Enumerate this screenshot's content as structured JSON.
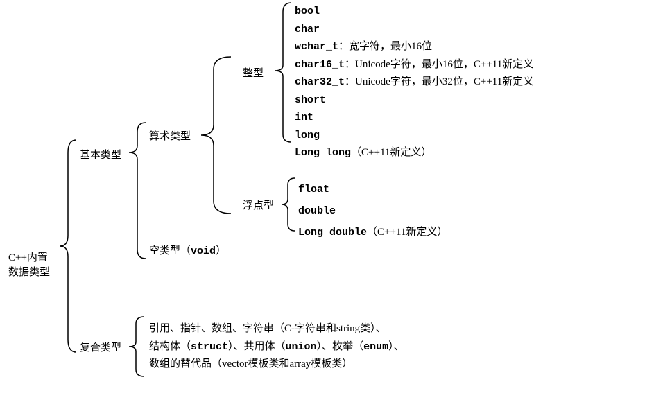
{
  "root": {
    "line1": "C++内置",
    "line2": "数据类型"
  },
  "level1": {
    "basic": "基本类型",
    "compound": "复合类型"
  },
  "level2": {
    "arithmetic": "算术类型",
    "void_label": "空类型（",
    "void_kw": "void",
    "void_close": "）"
  },
  "level3": {
    "integer": "整型",
    "float": "浮点型"
  },
  "integers": {
    "bool": "bool",
    "char": "char",
    "wchar_t": "wchar_t",
    "wchar_desc": "：宽字符，最小16位",
    "char16_t": "char16_t",
    "char16_desc": "：Unicode字符，最小16位，C++11新定义",
    "char32_t": "char32_t",
    "char32_desc": "：Unicode字符，最小32位，C++11新定义",
    "short": "short",
    "int": "int",
    "long": "long",
    "longlong": "Long long",
    "longlong_desc": "（C++11新定义）"
  },
  "floats": {
    "float": "float",
    "double": "double",
    "longdouble": "Long double",
    "longdouble_desc": "（C++11新定义）"
  },
  "compound": {
    "line1_a": "引用、指针、数组、字符串（C-字符串和string类）、",
    "line2_a": "结构体（",
    "struct": "struct",
    "line2_b": "）、共用体（",
    "union": "union",
    "line2_c": "）、枚举（",
    "enum": "enum",
    "line2_d": "）、",
    "line3": "数组的替代品（vector模板类和array模板类）"
  }
}
